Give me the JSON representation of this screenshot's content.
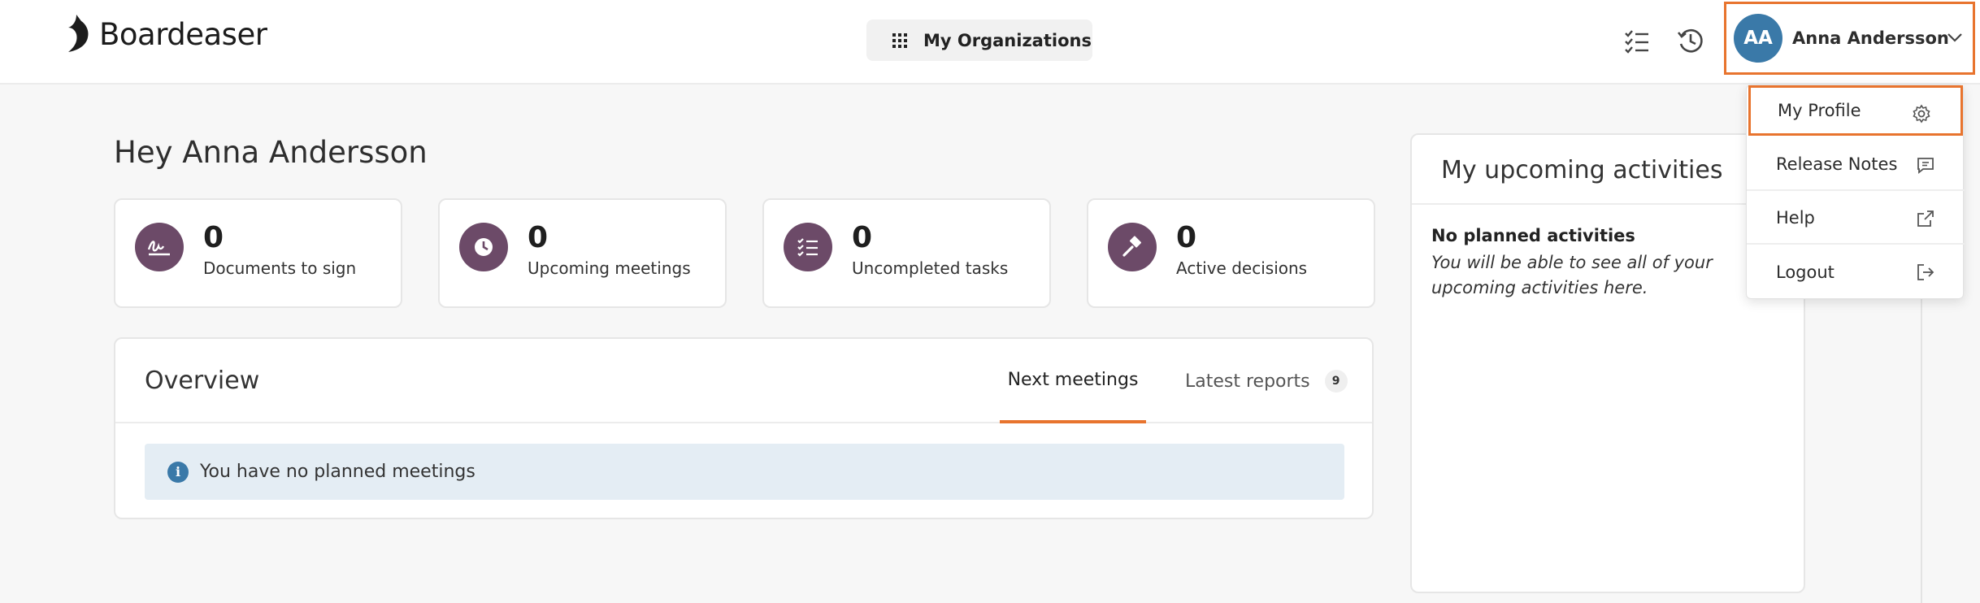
{
  "header": {
    "logo_text": "Boardeaser",
    "org_button_label": "My Organizations",
    "user": {
      "initials": "AA",
      "name": "Anna Andersson"
    }
  },
  "user_menu": {
    "items": [
      {
        "label": "My Profile",
        "icon": "gear-icon",
        "highlighted": true
      },
      {
        "label": "Release Notes",
        "icon": "message-icon"
      },
      {
        "label": "Help",
        "icon": "external-link-icon"
      },
      {
        "label": "Logout",
        "icon": "logout-icon"
      }
    ]
  },
  "dashboard": {
    "greeting": "Hey Anna Andersson",
    "stats": [
      {
        "value": "0",
        "label": "Documents to sign",
        "icon": "signature-icon"
      },
      {
        "value": "0",
        "label": "Upcoming meetings",
        "icon": "clock-icon"
      },
      {
        "value": "0",
        "label": "Uncompleted tasks",
        "icon": "checklist-icon"
      },
      {
        "value": "0",
        "label": "Active decisions",
        "icon": "gavel-icon"
      }
    ],
    "overview": {
      "title": "Overview",
      "tabs": [
        {
          "label": "Next meetings",
          "active": true
        },
        {
          "label": "Latest reports",
          "badge": "9"
        }
      ],
      "info_message": "You have no planned meetings"
    },
    "activities": {
      "title": "My upcoming activities",
      "empty_title": "No planned activities",
      "empty_text": "You will be able to see all of your upcoming activities here."
    }
  },
  "colors": {
    "accent_orange": "#e8742e",
    "stat_icon_bg": "#6c4a68",
    "avatar_bg": "#3a79a8",
    "info_bg": "#e4edf4"
  }
}
